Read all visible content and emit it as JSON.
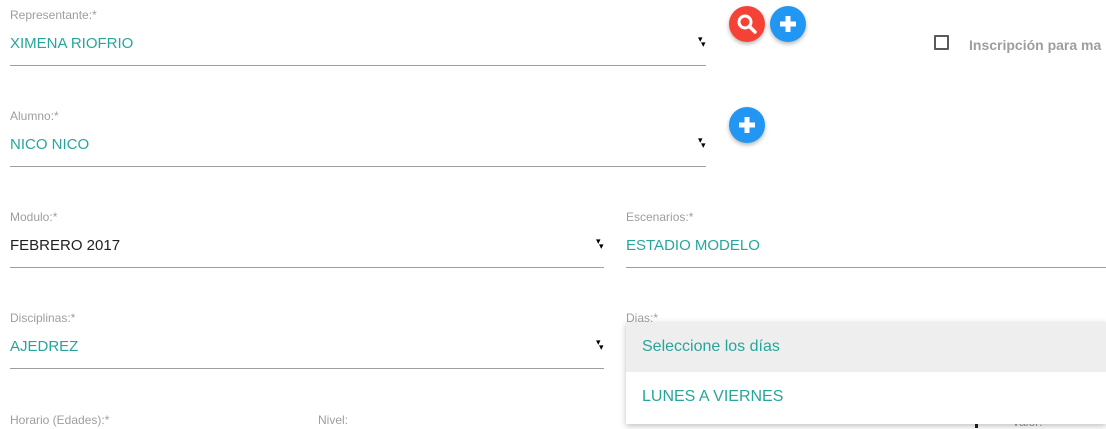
{
  "representante": {
    "label": "Representante:*",
    "value": "XIMENA RIOFRIO"
  },
  "inscripcion": {
    "label": "Inscripción para ma"
  },
  "alumno": {
    "label": "Alumno:*",
    "value": "NICO NICO"
  },
  "modulo": {
    "label": "Modulo:*",
    "value": "FEBRERO 2017"
  },
  "escenarios": {
    "label": "Escenarios:*",
    "value": "ESTADIO MODELO"
  },
  "disciplinas": {
    "label": "Disciplinas:*",
    "value": "AJEDREZ"
  },
  "dias": {
    "label": "Dias:*",
    "options": [
      "Seleccione los días",
      "LUNES A VIERNES"
    ]
  },
  "horario": {
    "label": "Horario (Edades):*"
  },
  "nivel": {
    "label": "Nivel:"
  },
  "valor": {
    "label": "Valor:"
  },
  "colors": {
    "teal": "#26a69a",
    "blue_fab": "#2196f3",
    "red_fab": "#f44336"
  },
  "icons": [
    "search-icon",
    "plus-icon",
    "caret-down-icon"
  ]
}
